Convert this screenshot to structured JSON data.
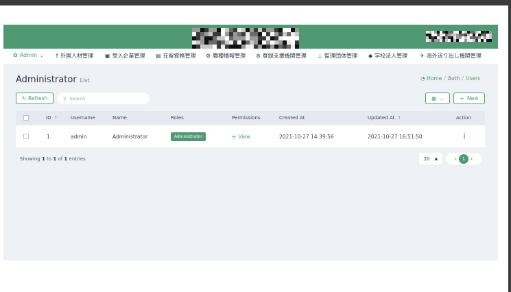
{
  "colors": {
    "brand": "#4f9a73",
    "app_bg": "#eef1f6",
    "frame": "#3b3b3b"
  },
  "header": {
    "logo_icon": "pixelated-logo",
    "user_icon": "pixelated-user-info"
  },
  "nav": {
    "items": [
      {
        "label": "Admin",
        "icon": "palette-icon",
        "has_dropdown": true
      },
      {
        "label": "外国人材管理",
        "icon": "person-icon"
      },
      {
        "label": "受入企業管理",
        "icon": "building-icon"
      },
      {
        "label": "在留資格管理",
        "icon": "id-card-icon"
      },
      {
        "label": "職種情報管理",
        "icon": "cogs-icon"
      },
      {
        "label": "登録支援機関管理",
        "icon": "handshake-icon"
      },
      {
        "label": "監理団体管理",
        "icon": "sitemap-icon"
      },
      {
        "label": "学校法人管理",
        "icon": "graduation-cap-icon"
      },
      {
        "label": "海外送り出し機関管理",
        "icon": "plane-icon"
      }
    ]
  },
  "page": {
    "title": "Administrator",
    "subtitle": "List",
    "breadcrumb": {
      "home": "Home",
      "sep": "/",
      "auth": "Auth",
      "users": "Users"
    }
  },
  "toolbar": {
    "refresh_label": "Refresh",
    "search_placeholder": "Search",
    "new_label": "New",
    "plus": "+"
  },
  "table": {
    "headers": {
      "id": "ID",
      "username": "Username",
      "name": "Name",
      "roles": "Roles",
      "permissions": "Permissions",
      "created_at": "Created At",
      "updated_at": "Updated At",
      "action": "Action"
    },
    "rows": [
      {
        "id": "1",
        "username": "admin",
        "name": "Administrator",
        "role": "Administrator",
        "permissions": "View",
        "created_at": "2021-10-27 14:39:56",
        "updated_at": "2021-10-27 16:51:50"
      }
    ]
  },
  "footer": {
    "showing_prefix": "Showing",
    "from": "1",
    "to_word": "to",
    "to": "1",
    "of_word": "of",
    "total": "1",
    "entries_word": "entries",
    "per_page": "20",
    "current_page": "1"
  }
}
